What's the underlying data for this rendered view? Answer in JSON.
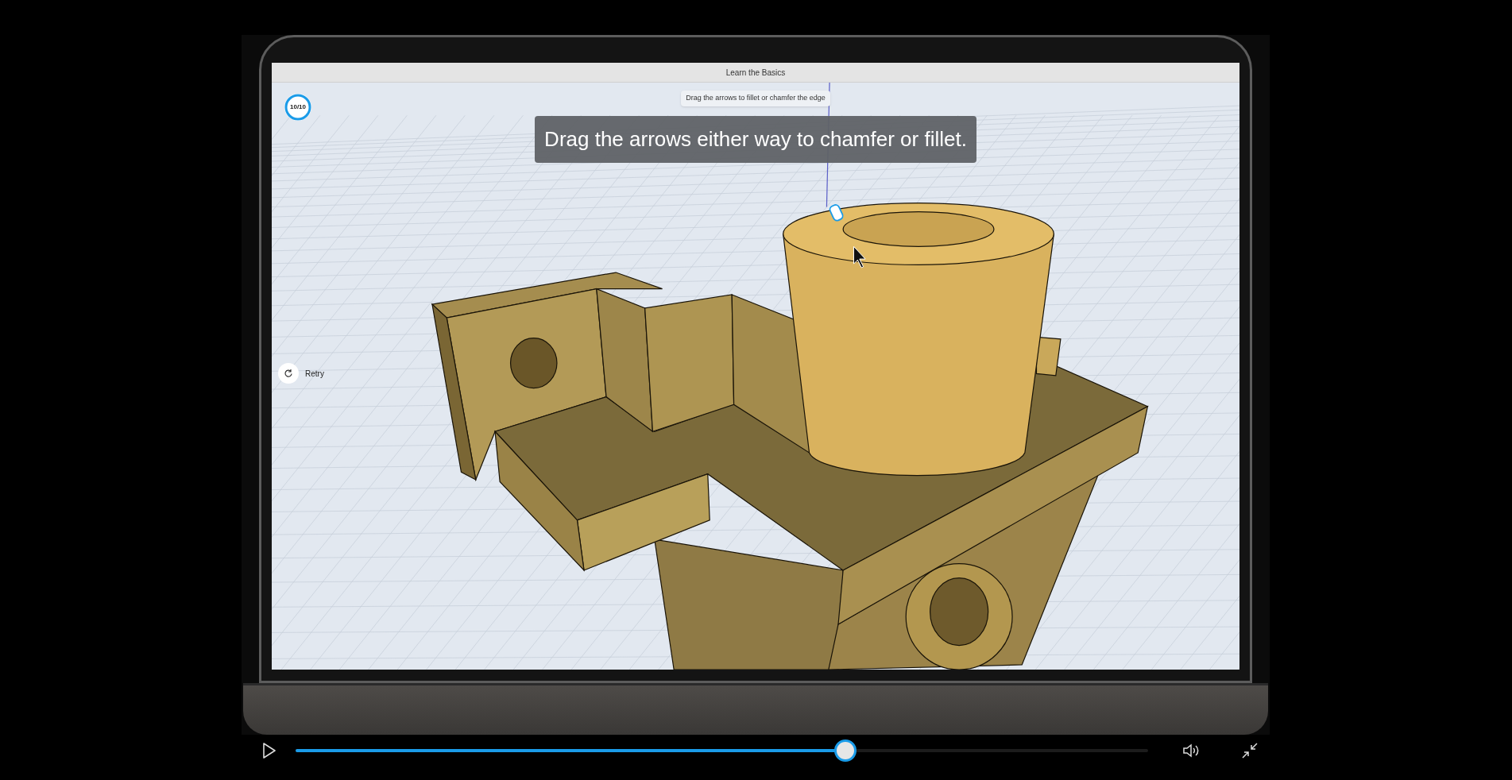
{
  "player": {
    "window": {
      "title": "Learn the Basics"
    },
    "progress_badge": {
      "label": "10/10"
    },
    "hint": "Drag the arrows to fillet or chamfer the edge",
    "caption": "Drag the arrows either way to chamfer or fillet.",
    "retry": {
      "label": "Retry"
    }
  },
  "controls": {
    "playing": false,
    "seek": {
      "level": 0.645
    }
  }
}
